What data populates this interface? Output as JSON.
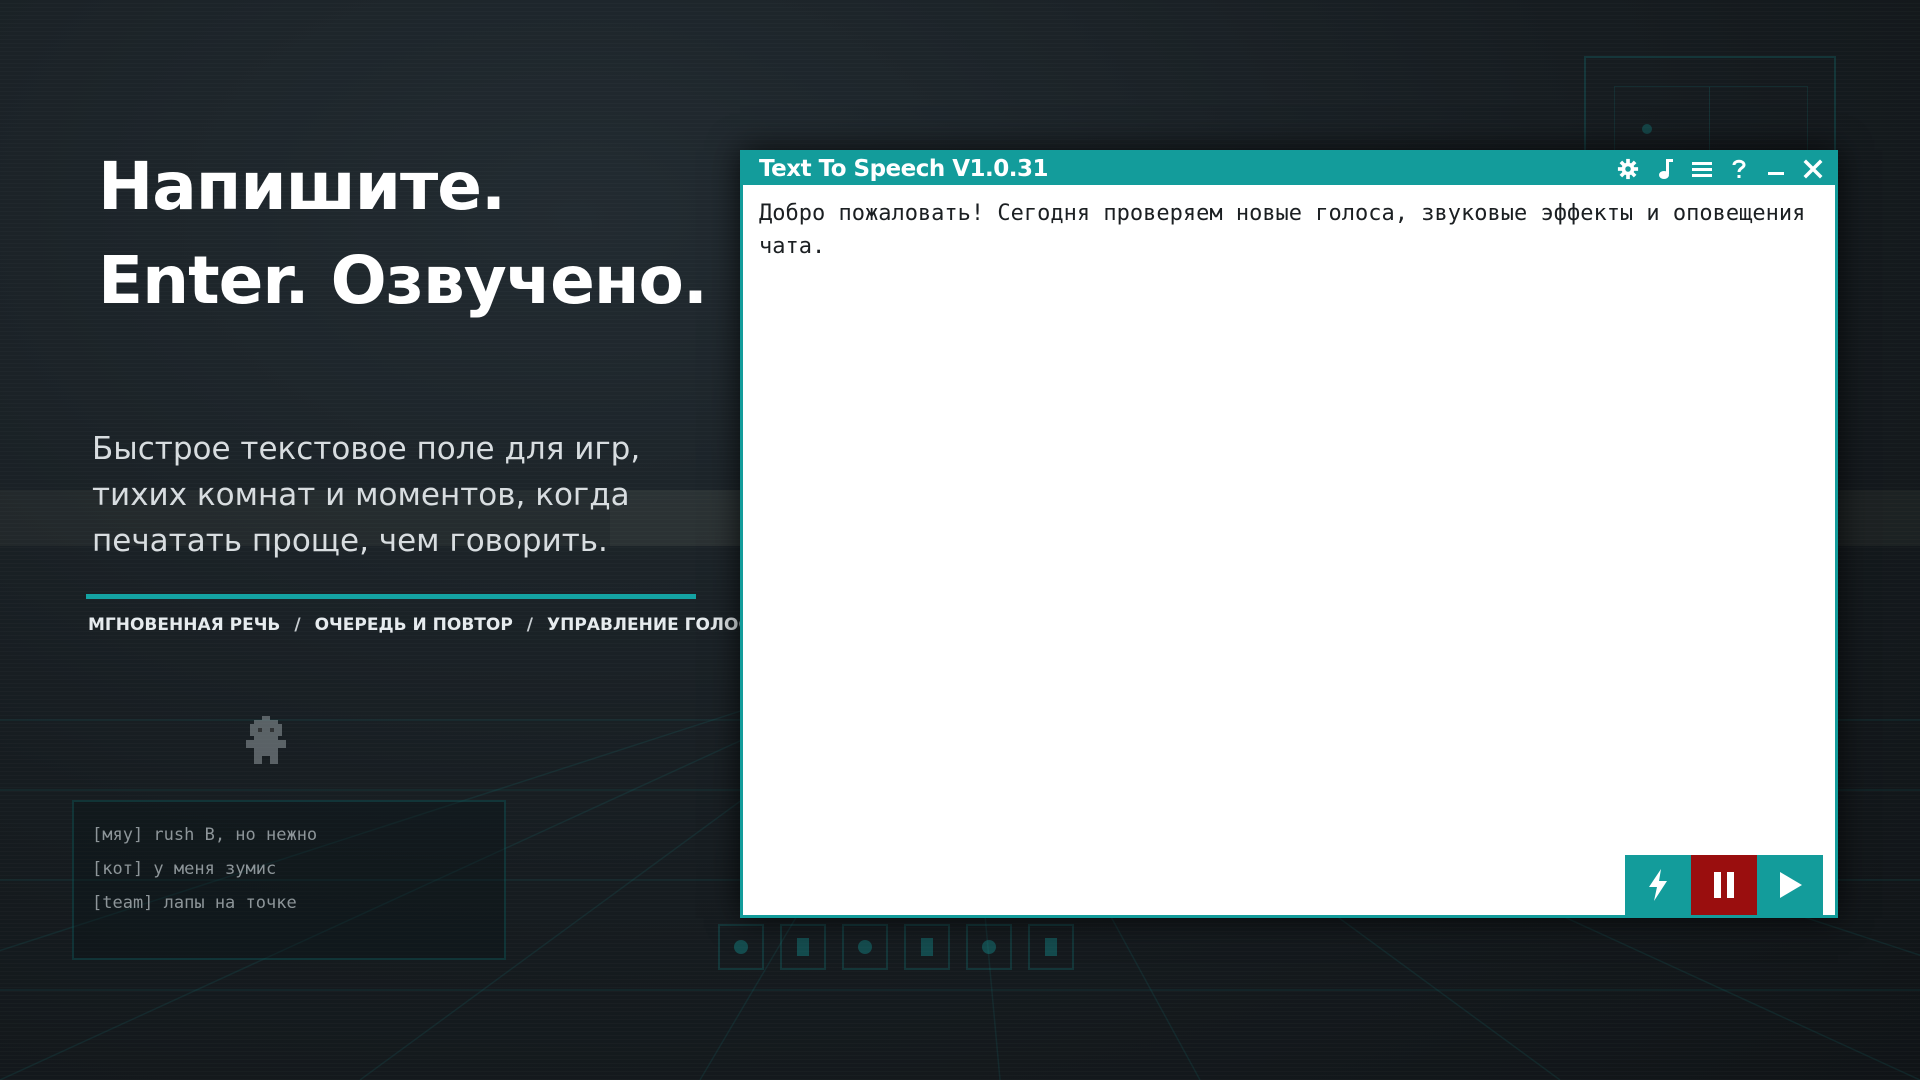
{
  "hero": {
    "line1": "Напишите.",
    "line2": "Enter. Озвучено.",
    "subtitle": "Быстрое текстовое поле для игр, тихих комнат и моментов, когда печатать проще, чем говорить."
  },
  "features": [
    "МГНОВЕННАЯ РЕЧЬ",
    "ОЧЕРЕДЬ И ПОВТОР",
    "УПРАВЛЕНИЕ ГОЛОСОМ"
  ],
  "feature_separator": "/",
  "chat": {
    "lines": [
      "[мяу] rush B, но нежно",
      "[кот] у меня зумис",
      "[team] лапы на точке"
    ]
  },
  "window": {
    "title": "Text To Speech V1.0.31",
    "titlebar_icons": [
      "gear-icon",
      "music-note-icon",
      "menu-icon",
      "help-icon",
      "minimize-icon",
      "close-icon"
    ],
    "text_value": "Добро пожаловать! Сегодня проверяем новые голоса, звуковые эффекты и оповещения чата.",
    "actions": [
      "flash-icon",
      "pause-icon",
      "play-icon"
    ]
  },
  "colors": {
    "accent": "#139c9b",
    "pause": "#9a0e0e",
    "background": "#14191d"
  }
}
